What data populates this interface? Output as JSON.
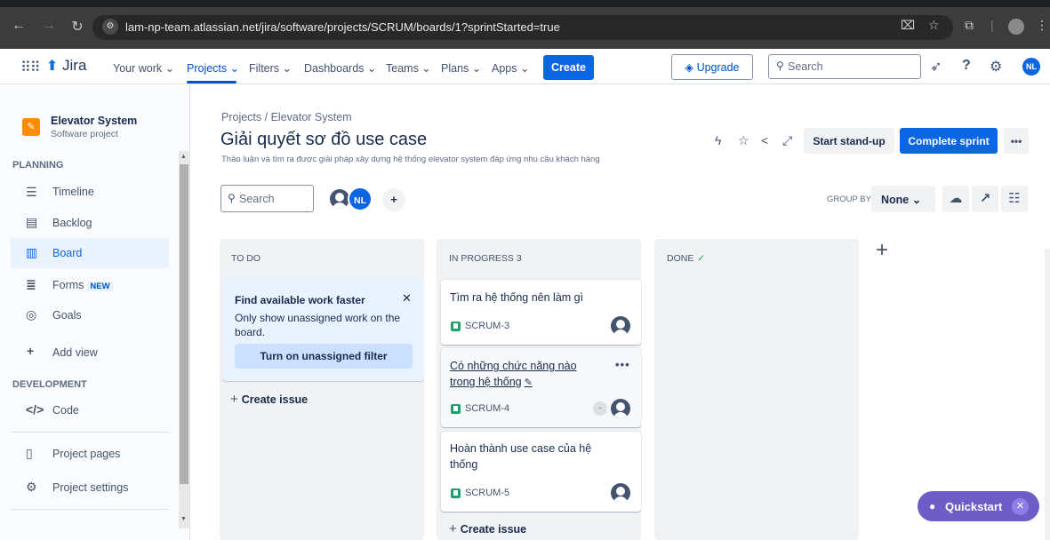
{
  "browser": {
    "url": "lam-np-team.atlassian.net/jira/software/projects/SCRUM/boards/1?sprintStarted=true",
    "back_icon": "arrow-left-icon",
    "forward_icon": "arrow-right-icon",
    "reload_icon": "reload-icon"
  },
  "topnav": {
    "product": "Jira",
    "your_work": "Your work ⌄",
    "projects": "Projects ⌄",
    "filters": "Filters ⌄",
    "dashboards": "Dashboards ⌄",
    "teams": "Teams ⌄",
    "plans": "Plans ⌄",
    "apps": "Apps ⌄",
    "create": "Create",
    "upgrade": "Upgrade",
    "search_placeholder": "Search",
    "avatar_initials": "NL"
  },
  "sidebar": {
    "project_name": "Elevator System",
    "project_type": "Software project",
    "planning_heading": "PLANNING",
    "development_heading": "DEVELOPMENT",
    "items": {
      "timeline": "Timeline",
      "backlog": "Backlog",
      "board": "Board",
      "forms": "Forms",
      "forms_badge": "NEW",
      "goals": "Goals",
      "add_view": "Add view",
      "code": "Code",
      "project_pages": "Project pages",
      "project_settings": "Project settings"
    }
  },
  "header": {
    "breadcrumb": "Projects / Elevator System",
    "title": "Giải quyết sơ đồ use case",
    "goal": "Thảo luận và tìm ra được giải pháp xây dựng hệ thống elevator system đáp ứng nhu cầu khách hàng",
    "standup": "Start stand-up",
    "complete": "Complete sprint",
    "more": "•••"
  },
  "toolbar": {
    "search_placeholder": "Search",
    "avatar_initials": "NL",
    "group_by_label": "GROUP BY",
    "group_by_value": "None ⌄"
  },
  "columns": {
    "todo": "TO DO",
    "in_progress": "IN PROGRESS 3",
    "done": "DONE"
  },
  "hint": {
    "title": "Find available work faster",
    "body": "Only show unassigned work on the board.",
    "button": "Turn on unassigned filter"
  },
  "create_issue": "Create issue",
  "issues": [
    {
      "summary": "Tìm ra hệ thống nên làm gì",
      "key": "SCRUM-3"
    },
    {
      "summary": "Có những chức năng nào trong hệ thống",
      "key": "SCRUM-4",
      "estimate": "-"
    },
    {
      "summary": "Hoàn thành use case của hệ thống",
      "key": "SCRUM-5"
    }
  ],
  "quickstart": "Quickstart",
  "colors": {
    "primary": "#0c66e4",
    "column_bg": "#f1f2f4",
    "quickstart": "#6e5dc6",
    "story": "#22a06b"
  }
}
